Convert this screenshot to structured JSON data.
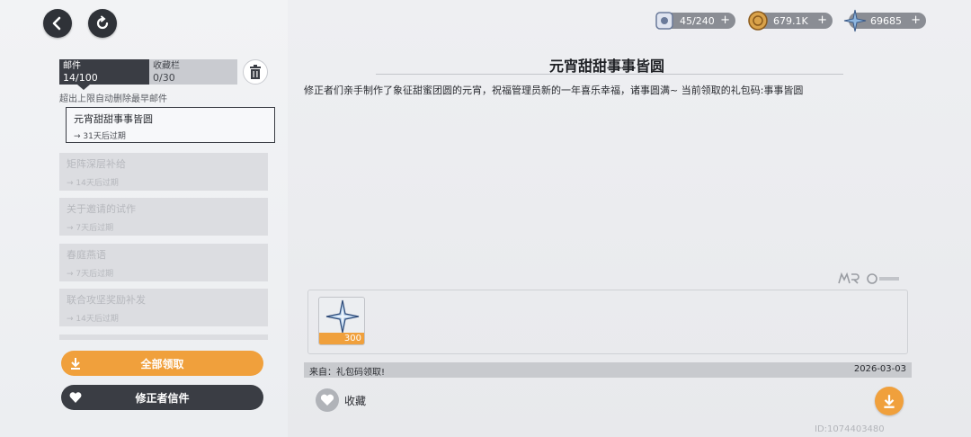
{
  "nav": {
    "back_icon": "arrow-left-icon",
    "refresh_icon": "refresh-icon"
  },
  "tabs": {
    "mail": {
      "label": "邮件",
      "count": "14/100"
    },
    "favorites": {
      "label": "收藏栏",
      "count": "0/30"
    }
  },
  "hint": "超出上限自动删除最早邮件",
  "mail_list": [
    {
      "title": "元宵甜甜事事皆圆",
      "expiry": "31天后过期",
      "selected": true
    },
    {
      "title": "矩阵深层补给",
      "expiry": "14天后过期"
    },
    {
      "title": "关于邀请的试作",
      "expiry": "7天后过期"
    },
    {
      "title": "春庭燕语",
      "expiry": "7天后过期"
    },
    {
      "title": "联合攻坚奖励补发",
      "expiry": "14天后过期"
    }
  ],
  "buttons": {
    "claim_all": "全部领取",
    "corrector_letter": "修正者信件",
    "favorite": "收藏"
  },
  "currency": {
    "stamina": {
      "value": "45/240",
      "icon": "stamina-icon"
    },
    "coins": {
      "value": "679.1K",
      "icon": "coin-icon"
    },
    "crystal": {
      "value": "69685",
      "icon": "crystal-icon"
    }
  },
  "mail_detail": {
    "title": "元宵甜甜事事皆圆",
    "body": "修正者们亲手制作了象征甜蜜团圆的元宵，祝福管理员新的一年喜乐幸福，诸事圆满~ 当前领取的礼包码:事事皆圆",
    "reward_qty": "300",
    "from": "来自：礼包码领取!",
    "date": "2026-03-03",
    "uid": "ID:1074403480"
  },
  "colors": {
    "accent": "#f0a03c",
    "dark": "#3a3d44"
  }
}
